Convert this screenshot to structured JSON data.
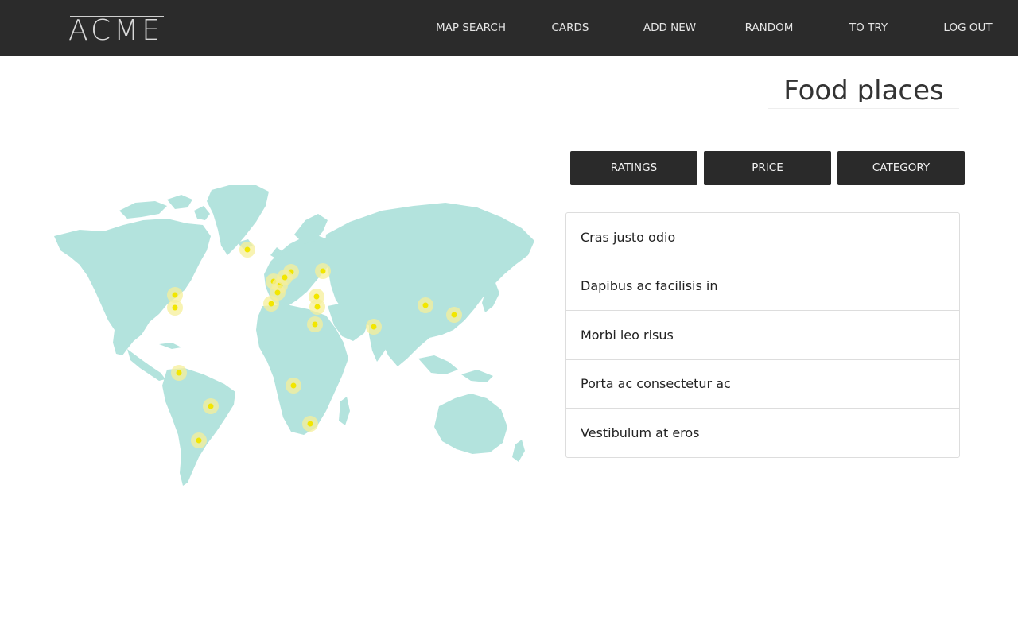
{
  "brand": {
    "logo_text": "ACME"
  },
  "nav": {
    "items": [
      {
        "label": "MAP SEARCH"
      },
      {
        "label": "CARDS"
      },
      {
        "label": "ADD NEW"
      },
      {
        "label": "RANDOM"
      },
      {
        "label": "TO TRY"
      },
      {
        "label": "LOG OUT"
      }
    ]
  },
  "page": {
    "title": "Food places"
  },
  "filters": [
    {
      "label": "RATINGS"
    },
    {
      "label": "PRICE"
    },
    {
      "label": "CATEGORY"
    }
  ],
  "places": [
    {
      "name": "Cras justo odio"
    },
    {
      "name": "Dapibus ac facilisis in"
    },
    {
      "name": "Morbi leo risus"
    },
    {
      "name": "Porta ac consectetur ac"
    },
    {
      "name": "Vestibulum at eros"
    }
  ],
  "colors": {
    "navbar": "#2b2b2b",
    "land": "#b3e3dd",
    "marker": "#f2e600",
    "marker_halo": "#f6ef9a",
    "button": "#2a2a2a"
  },
  "map": {
    "marker_count": 21,
    "marker_icon": "map-pin-icon"
  }
}
